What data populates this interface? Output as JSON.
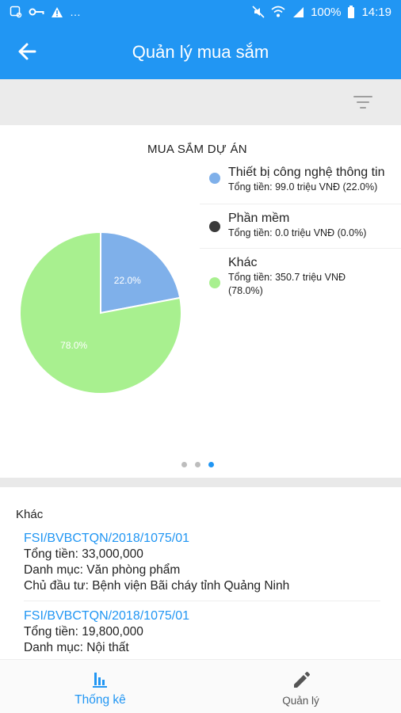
{
  "status_bar": {
    "battery": "100%",
    "time": "14:19",
    "left_icons": [
      "photo-notification-icon",
      "key-icon",
      "warning-icon",
      "more-dots"
    ],
    "right_icons": [
      "mute-icon",
      "wifi-icon",
      "signal-icon",
      "battery-icon"
    ]
  },
  "app_bar": {
    "title": "Quản lý mua sắm",
    "back_icon": "arrow-left-icon",
    "color": "#2196f3"
  },
  "filter_bar": {
    "icon": "filter-icon"
  },
  "chart_data": {
    "type": "pie",
    "title": "MUA SẮM DỰ ÁN",
    "categories": [
      "Thiết bị công nghệ thông tin",
      "Phần mềm",
      "Khác"
    ],
    "values": [
      22.0,
      0.0,
      78.0
    ],
    "slice_labels": [
      "22.0%",
      "0.0%",
      "78.0%"
    ],
    "colors": [
      "#7fb0ea",
      "#3a3a3a",
      "#a8f08f"
    ],
    "legend_placement": "right"
  },
  "legend": [
    {
      "name": "Thiết bị công nghệ thông tin",
      "total": "Tổng tiền: 99.0 triệu VNĐ (22.0%)",
      "color": "#7fb0ea"
    },
    {
      "name": "Phần mềm",
      "total": "Tổng tiền: 0.0 triệu VNĐ (0.0%)",
      "color": "#3a3a3a"
    },
    {
      "name": "Khác",
      "total": "Tổng tiền: 350.7 triệu VNĐ (78.0%)",
      "color": "#a8f08f"
    }
  ],
  "pager": {
    "count": 3,
    "active": 3
  },
  "list": {
    "group_title": "Khác",
    "entries": [
      {
        "code": "FSI/BVBCTQN/2018/1075/01",
        "total": "Tổng tiền: 33,000,000",
        "category": "Danh mục: Văn phòng phẩm",
        "investor": "Chủ đầu tư: Bệnh viện Bãi cháy tỉnh Quảng Ninh"
      },
      {
        "code": "FSI/BVBCTQN/2018/1075/01",
        "total": "Tổng tiền: 19,800,000",
        "category": "Danh mục: Nội thất"
      }
    ]
  },
  "bottom_nav": {
    "stats_label": "Thống kê",
    "manage_label": "Quản lý",
    "active_color": "#2196f3"
  }
}
